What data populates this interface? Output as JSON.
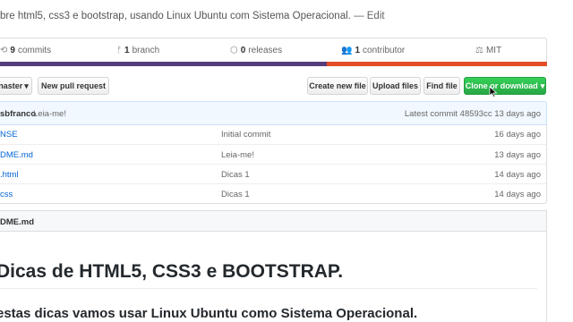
{
  "repo": {
    "description": "bre html5, css3 e bootstrap, usando Linux Ubuntu com Sistema Operacional.",
    "edit_label": "— Edit"
  },
  "summary": {
    "commits_count": "9",
    "commits_label": "commits",
    "branch_count": "1",
    "branch_label": "branch",
    "releases_count": "0",
    "releases_label": "releases",
    "contributors_count": "1",
    "contributors_label": "contributor",
    "license": "MIT"
  },
  "colors": {
    "lang_primary": "#563d7c",
    "lang_secondary": "#e34c26",
    "accent_green": "#28a745"
  },
  "toolbar": {
    "branch_label": "naster",
    "new_pr_label": "New pull request",
    "create_file_label": "Create new file",
    "upload_label": "Upload files",
    "find_label": "Find file",
    "clone_label": "Clone or download"
  },
  "commit": {
    "author": "sbfranco",
    "message": "Leia-me!",
    "latest_label": "Latest commit",
    "sha": "48593cc",
    "age": "13 days ago"
  },
  "files": [
    {
      "name": "NSE",
      "message": "Initial commit",
      "age": "16 days ago"
    },
    {
      "name": "DME.md",
      "message": "Leia-me!",
      "age": "13 days ago"
    },
    {
      "name": ".html",
      "message": "Dicas 1",
      "age": "14 days ago"
    },
    {
      "name": "css",
      "message": "Dicas 1",
      "age": "14 days ago"
    }
  ],
  "readme": {
    "filename": "DME.md",
    "heading": "Dicas de HTML5, CSS3 e BOOTSTRAP.",
    "subheading": "estas dicas vamos usar Linux Ubuntu como Sistema Operacional."
  }
}
